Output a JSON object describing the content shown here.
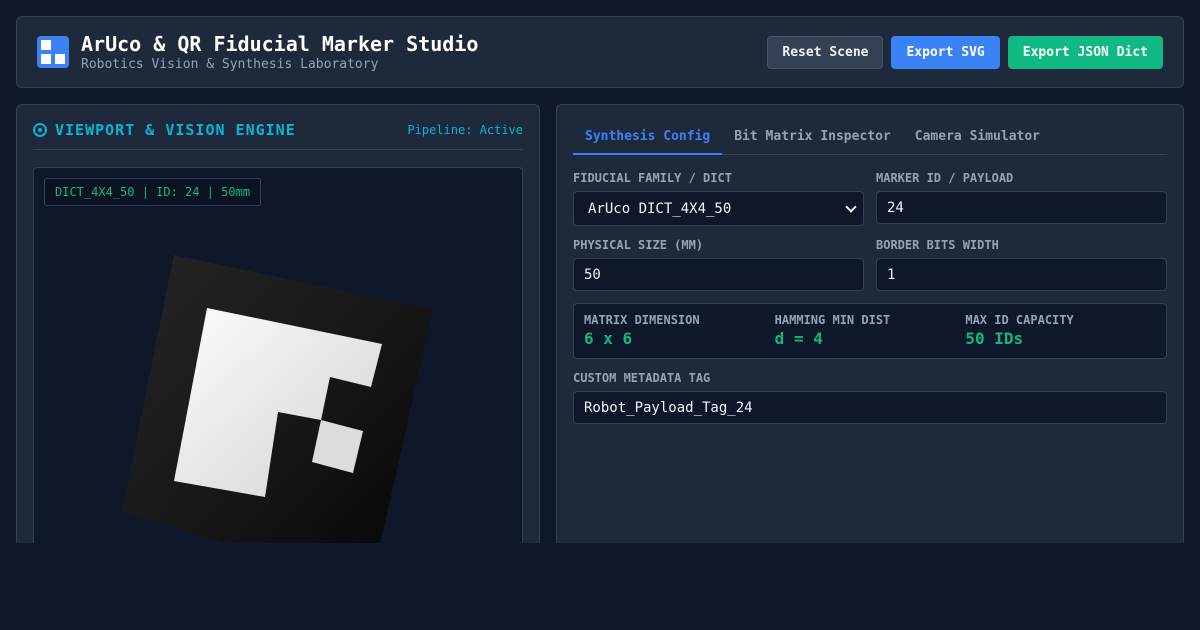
{
  "header": {
    "title": "ArUco & QR Fiducial Marker Studio",
    "subtitle": "Robotics Vision & Synthesis Laboratory",
    "buttons": {
      "reset": "Reset Scene",
      "export_svg": "Export SVG",
      "export_json": "Export JSON Dict"
    }
  },
  "viewport": {
    "title": "VIEWPORT & VISION ENGINE",
    "pipeline": "Pipeline: Active",
    "badge": "DICT_4X4_50 | ID: 24 | 50mm"
  },
  "tabs": [
    "Synthesis Config",
    "Bit Matrix Inspector",
    "Camera Simulator"
  ],
  "form": {
    "family_label": "FIDUCIAL FAMILY / DICT",
    "family_value": "ArUco DICT_4X4_50",
    "marker_id_label": "MARKER ID / PAYLOAD",
    "marker_id_value": "24",
    "size_label": "PHYSICAL SIZE (MM)",
    "size_value": "50",
    "border_label": "BORDER BITS WIDTH",
    "border_value": "1",
    "metadata_label": "CUSTOM METADATA TAG",
    "metadata_value": "Robot_Payload_Tag_24"
  },
  "stats": [
    {
      "label": "MATRIX DIMENSION",
      "value": "6 x 6"
    },
    {
      "label": "HAMMING MIN DIST",
      "value": "d = 4"
    },
    {
      "label": "MAX ID CAPACITY",
      "value": "50 IDs"
    }
  ],
  "colors": {
    "accent_blue": "#3b82f6",
    "accent_green": "#10b981",
    "accent_cyan": "#06b6d4",
    "background": "#0f172a",
    "panel": "#1e293b"
  },
  "icons": {
    "logo": "grid-logo-icon",
    "viewport": "target-icon",
    "select": "chevron-down-icon"
  }
}
